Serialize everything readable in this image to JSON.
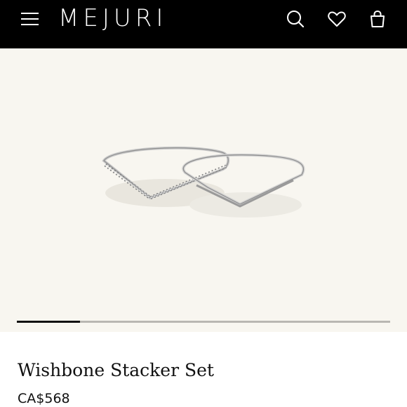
{
  "header": {
    "brand": "MEJURI",
    "icons": {
      "menu": "hamburger-menu-icon",
      "search": "search-icon",
      "wishlist": "heart-icon",
      "cart": "shopping-bag-icon"
    }
  },
  "gallery": {
    "image_alt": "rings",
    "progress": 0.17,
    "background": "#f8f6f0"
  },
  "product": {
    "title": "Wishbone Stacker Set",
    "price": "CA$568"
  },
  "colors": {
    "header_bg": "#000000",
    "text": "#111111",
    "track": "#b9b7b2"
  }
}
